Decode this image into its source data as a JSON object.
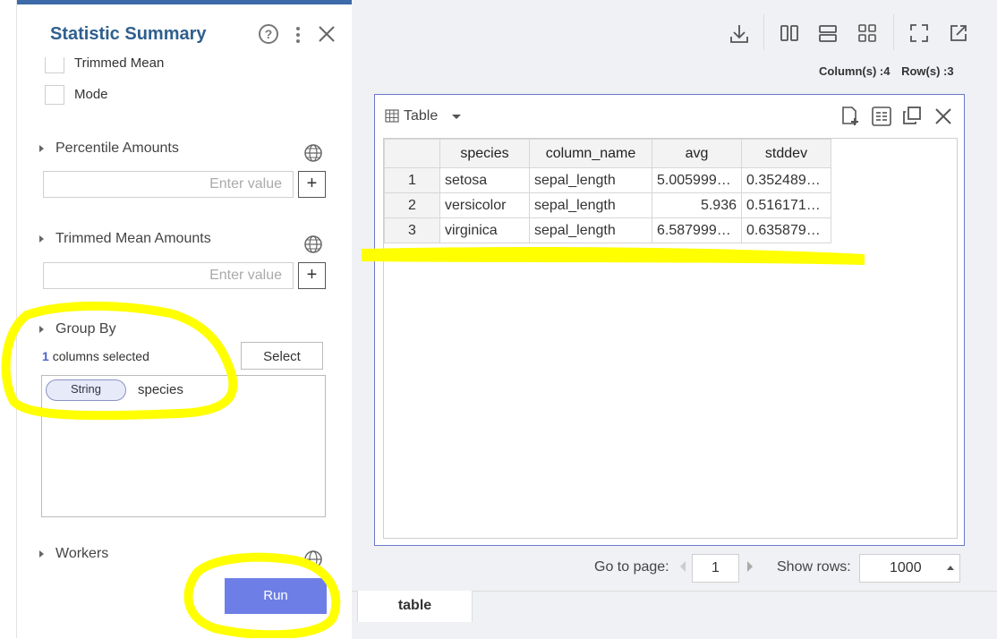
{
  "panel": {
    "title": "Statistic Summary",
    "options": [
      {
        "label": "Trimmed Mean",
        "checked": false
      },
      {
        "label": "Mode",
        "checked": false
      }
    ],
    "percentile": {
      "title": "Percentile Amounts",
      "placeholder": "Enter value"
    },
    "trimmed": {
      "title": "Trimmed Mean Amounts",
      "placeholder": "Enter value"
    },
    "group_by": {
      "title": "Group By",
      "count": "1",
      "count_suffix": "columns selected",
      "select_label": "Select",
      "columns": [
        {
          "type": "String",
          "name": "species"
        }
      ]
    },
    "workers": {
      "title": "Workers"
    },
    "run_label": "Run"
  },
  "toolbar": {
    "columns_label": "Column(s) :4",
    "rows_label": "Row(s) :3"
  },
  "table_view": {
    "label": "Table",
    "columns": [
      "species",
      "column_name",
      "avg",
      "stddev"
    ],
    "rows": [
      {
        "n": "1",
        "species": "setosa",
        "column_name": "sepal_length",
        "avg": "5.005999…",
        "stddev": "0.352489…"
      },
      {
        "n": "2",
        "species": "versicolor",
        "column_name": "sepal_length",
        "avg": "5.936",
        "stddev": "0.516171…"
      },
      {
        "n": "3",
        "species": "virginica",
        "column_name": "sepal_length",
        "avg": "6.587999…",
        "stddev": "0.635879…"
      }
    ]
  },
  "pager": {
    "goto_label": "Go to page:",
    "page": "1",
    "show_rows_label": "Show rows:",
    "rows_value": "1000"
  },
  "bottom_tab": "table",
  "colors": {
    "accent": "#3d6aa8",
    "run": "#6d7fe6",
    "highlight": "#ffff00"
  }
}
